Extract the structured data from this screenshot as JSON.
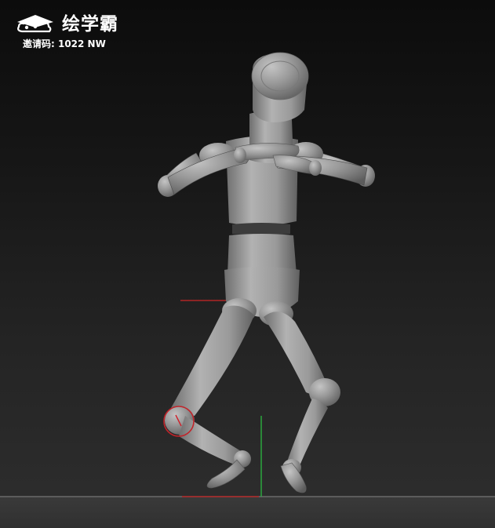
{
  "watermark": {
    "brand": "绘学霸",
    "invite_code": "邀请码: 1022 NW",
    "logo_icon": "cloud-cap-icon"
  },
  "viewport": {
    "content": "mannequin-figure",
    "grid_axis_colors": {
      "x_axis": "#b02525",
      "y_axis": "#2bb040",
      "floor_line": "#6a6a6a"
    },
    "model_color": "#8f8f8f",
    "selection_ring_color": "#c2242a"
  }
}
